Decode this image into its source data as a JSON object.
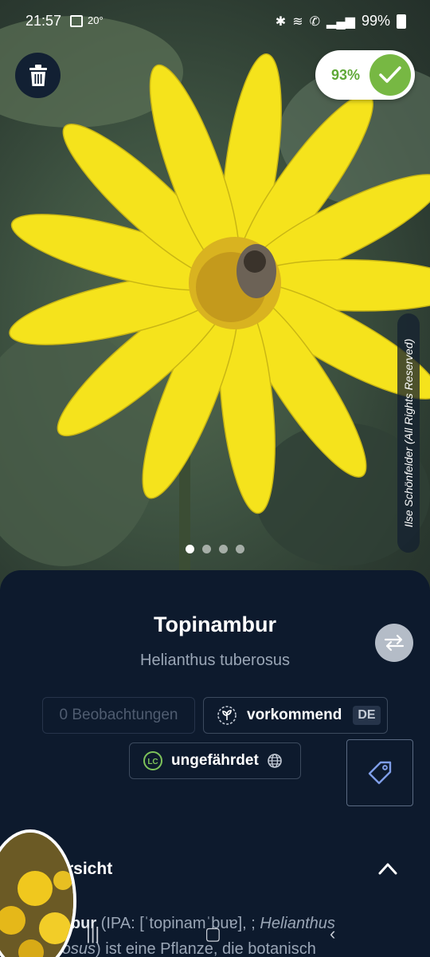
{
  "status_bar": {
    "time": "21:57",
    "temperature": "20°",
    "battery": "99%"
  },
  "photo": {
    "credit": "Ilse Schönfelder (All Rights Reserved)",
    "page_count": 4,
    "active_page": 1
  },
  "match": {
    "score": "93%"
  },
  "species": {
    "common_name": "Topinambur",
    "latin_name": "Helianthus tuberosus"
  },
  "chips": {
    "observations": "0 Beobachtungen",
    "occurrence": "vorkommend",
    "occurrence_region": "DE",
    "threat": "ungefährdet",
    "threat_code": "LC"
  },
  "overview": {
    "title": "Übersicht",
    "visible_title": "rsicht",
    "text_bold": "ambur",
    "text_1": " (IPA: [ˈtopinamˈbuɐ], ; ",
    "text_italic_1": "Helianthus",
    "text_italic_2": "erosus",
    "text_2": ") ist eine Pflanze, die botanisch"
  },
  "icons": {
    "delete": "trash-icon",
    "match": "check-icon",
    "swap": "swap-icon",
    "tag": "tag-icon",
    "collapse": "chevron-up-icon"
  },
  "colors": {
    "sheet_bg": "#0d1a2d",
    "match_green": "#77b843",
    "petal_yellow": "#f5e31c"
  }
}
